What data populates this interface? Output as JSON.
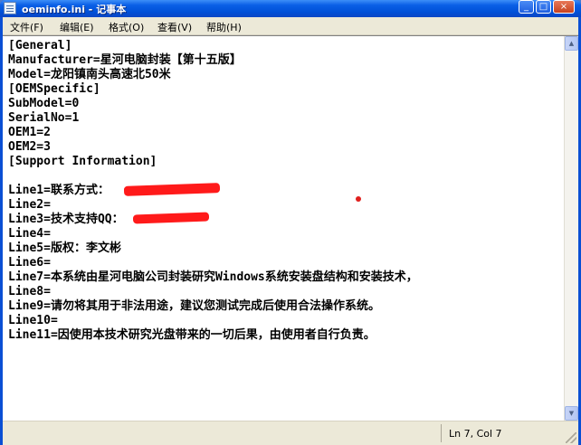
{
  "window": {
    "title": "oeminfo.ini - 记事本",
    "controls": {
      "minimize": "_",
      "maximize": "□",
      "close": "×"
    }
  },
  "menu": {
    "items": [
      "文件(F)",
      "编辑(E)",
      "格式(O)",
      "查看(V)",
      "帮助(H)"
    ]
  },
  "document": {
    "lines": [
      "[General]",
      "Manufacturer=星河电脑封装【第十五版】",
      "Model=龙阳镇南头高速北50米",
      "[OEMSpecific]",
      "SubModel=0",
      "SerialNo=1",
      "OEM1=2",
      "OEM2=3",
      "[Support Information]",
      "",
      "Line1=联系方式：",
      "Line2=",
      "Line3=技术支持QQ：",
      "Line4=",
      "Line5=版权：李文彬",
      "Line6=",
      "Line7=本系统由星河电脑公司封装研究Windows系统安装盘结构和安装技术，",
      "Line8=",
      "Line9=请勿将其用于非法用途，建议您测试完成后使用合法操作系统。",
      "Line10=",
      "Line11=因使用本技术研究光盘带来的一切后果，由使用者自行负责。"
    ]
  },
  "status": {
    "position": "Ln 7, Col 7"
  },
  "colors": {
    "titlebar": "#0a5fe6",
    "chrome": "#ece9d8",
    "redaction": "#ff1a1a"
  }
}
